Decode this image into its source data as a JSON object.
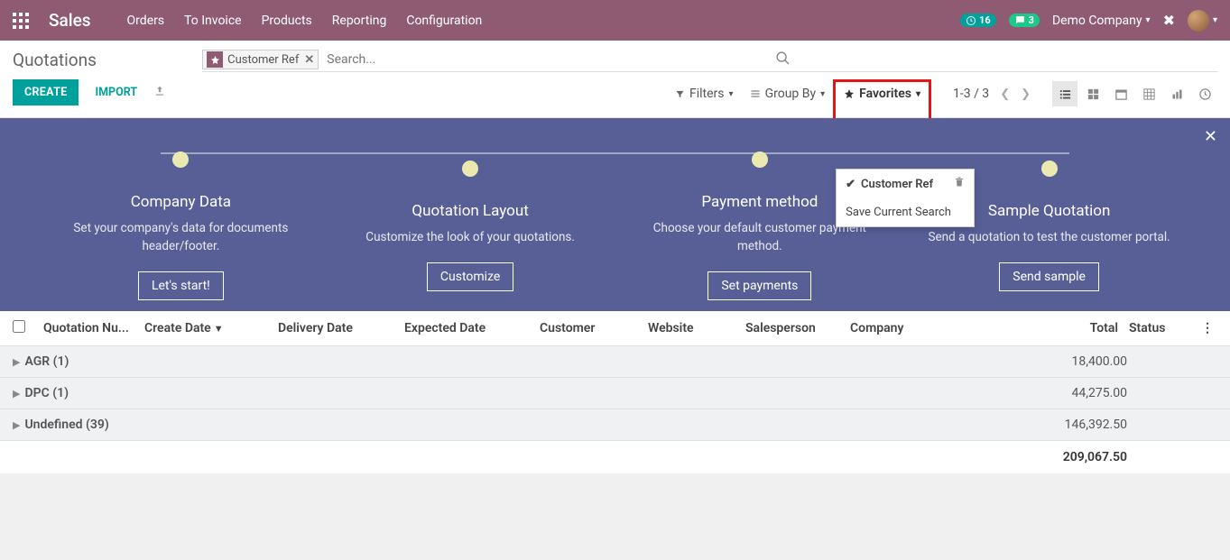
{
  "topbar": {
    "brand": "Sales",
    "menu": [
      "Orders",
      "To Invoice",
      "Products",
      "Reporting",
      "Configuration"
    ],
    "notifications_count": "16",
    "messages_count": "3",
    "company": "Demo Company"
  },
  "header": {
    "title": "Quotations",
    "create": "CREATE",
    "import": "IMPORT",
    "search_placeholder": "Search...",
    "facet_label": "Customer Ref",
    "filters_label": "Filters",
    "groupby_label": "Group By",
    "favorites_label": "Favorites",
    "pager": "1-3 / 3"
  },
  "favorites_dropdown": {
    "item_checked": "Customer Ref",
    "item_save": "Save Current Search"
  },
  "onboarding": {
    "steps": [
      {
        "title": "Company Data",
        "desc": "Set your company's data for documents header/footer.",
        "btn": "Let's start!"
      },
      {
        "title": "Quotation Layout",
        "desc": "Customize the look of your quotations.",
        "btn": "Customize"
      },
      {
        "title": "Payment method",
        "desc": "Choose your default customer payment method.",
        "btn": "Set payments"
      },
      {
        "title": "Sample Quotation",
        "desc": "Send a quotation to test the customer portal.",
        "btn": "Send sample"
      }
    ]
  },
  "table": {
    "columns": {
      "quotation_number": "Quotation Nu...",
      "create_date": "Create Date",
      "delivery_date": "Delivery Date",
      "expected_date": "Expected Date",
      "customer": "Customer",
      "website": "Website",
      "salesperson": "Salesperson",
      "company": "Company",
      "total": "Total",
      "status": "Status"
    },
    "groups": [
      {
        "label": "AGR (1)",
        "total": "18,400.00"
      },
      {
        "label": "DPC (1)",
        "total": "44,275.00"
      },
      {
        "label": "Undefined (39)",
        "total": "146,392.50"
      }
    ],
    "grand_total": "209,067.50"
  }
}
